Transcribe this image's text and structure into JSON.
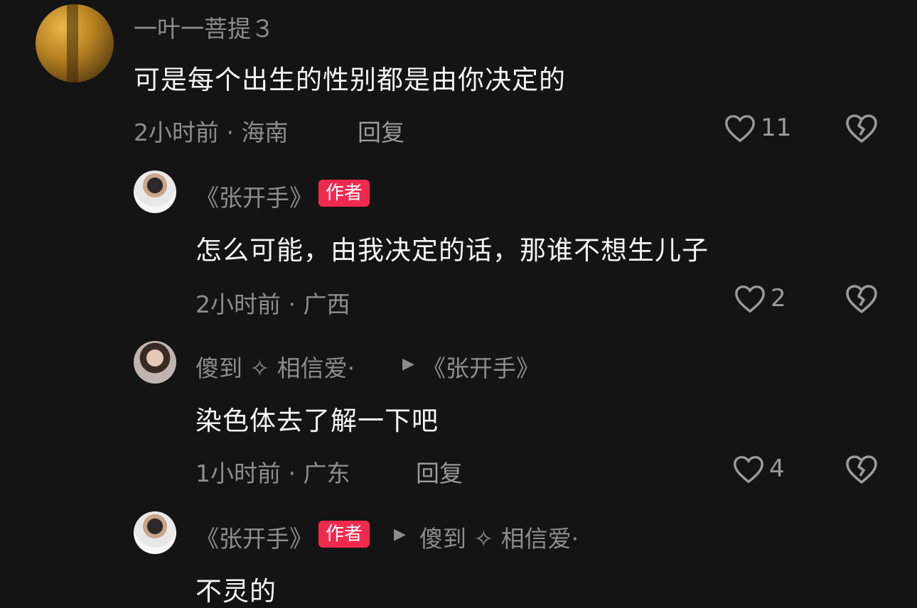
{
  "comments": [
    {
      "username": "一叶一菩提３",
      "text": "可是每个出生的性别都是由你决定的",
      "meta": "2小时前 · 海南",
      "reply_label": "回复",
      "likes": "11"
    },
    {
      "username": "《张开手》",
      "badge": "作者",
      "text": "怎么可能，由我决定的话，那谁不想生儿子",
      "meta": "2小时前 · 广西",
      "likes": "2"
    },
    {
      "username": "傻到 ✧ 相信爱·",
      "reply_to": "《张开手》",
      "text": "染色体去了解一下吧",
      "meta": "1小时前 · 广东",
      "reply_label": "回复",
      "likes": "4"
    },
    {
      "username": "《张开手》",
      "badge": "作者",
      "reply_to": "傻到 ✧ 相信爱·",
      "text": "不灵的"
    }
  ],
  "colors": {
    "background": "#141414",
    "badge": "#f2294f",
    "muted_text": "#8d8d8d"
  },
  "icons": {
    "like": "heart-outline-icon",
    "dislike": "broken-heart-icon",
    "reply_arrow": "play-arrow-icon"
  }
}
